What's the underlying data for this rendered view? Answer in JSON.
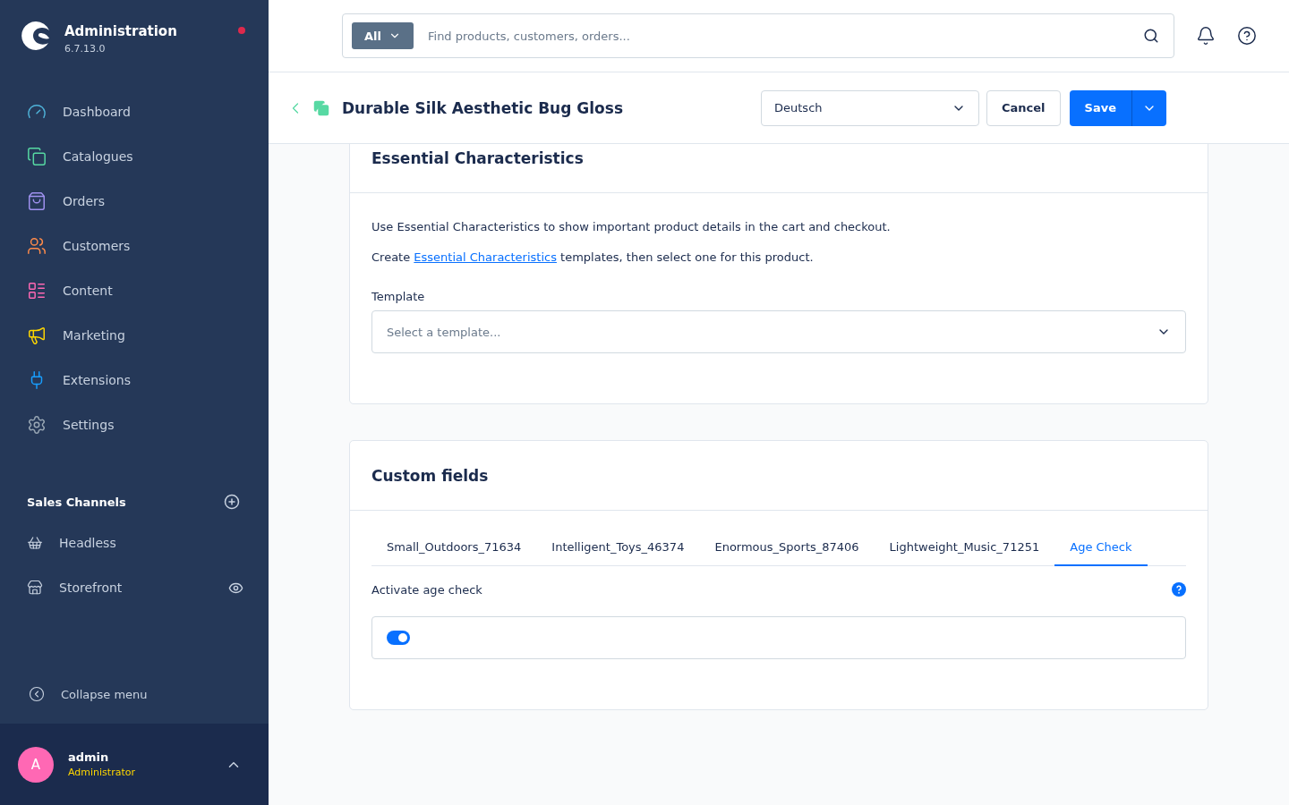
{
  "sidebar": {
    "brand": {
      "title": "Administration",
      "version": "6.7.13.0",
      "notification": true
    },
    "nav": [
      {
        "label": "Dashboard",
        "kind": "dashboard",
        "color": "#4fb3d9"
      },
      {
        "label": "Catalogues",
        "kind": "catalogues",
        "color": "#57d9a3"
      },
      {
        "label": "Orders",
        "kind": "orders",
        "color": "#a092f0"
      },
      {
        "label": "Customers",
        "kind": "customers",
        "color": "#ff8b4a"
      },
      {
        "label": "Content",
        "kind": "content",
        "color": "#ff68b4"
      },
      {
        "label": "Marketing",
        "kind": "marketing",
        "color": "#ffd700"
      },
      {
        "label": "Extensions",
        "kind": "extensions",
        "color": "#189eff"
      },
      {
        "label": "Settings",
        "kind": "settings",
        "color": "#9aa8b5"
      }
    ],
    "sales_channels": {
      "title": "Sales Channels",
      "items": [
        {
          "label": "Headless",
          "kind": "basket",
          "preview": false
        },
        {
          "label": "Storefront",
          "kind": "store",
          "preview": true
        }
      ]
    },
    "collapse": "Collapse menu",
    "user": {
      "initial": "A",
      "name": "admin",
      "role": "Administrator"
    }
  },
  "topbar": {
    "search": {
      "scope": "All",
      "placeholder": "Find products, customers, orders..."
    }
  },
  "header": {
    "title": "Durable Silk Aesthetic Bug Gloss",
    "language": "Deutsch",
    "buttons": {
      "cancel": "Cancel",
      "save": "Save"
    }
  },
  "essential": {
    "title": "Essential Characteristics",
    "intro": "Use Essential Characteristics to show important product details in the cart and checkout.",
    "before": "Create",
    "link": "Essential Characteristics",
    "after": "templates, then select one for this product.",
    "template_label": "Template",
    "template_placeholder": "Select a template..."
  },
  "custom_fields": {
    "title": "Custom fields",
    "tabs": [
      {
        "label": "Small_Outdoors_71634",
        "selected": false
      },
      {
        "label": "Intelligent_Toys_46374",
        "selected": false
      },
      {
        "label": "Enormous_Sports_87406",
        "selected": false
      },
      {
        "label": "Lightweight_Music_71251",
        "selected": false
      },
      {
        "label": "Age Check",
        "selected": true
      }
    ],
    "field_label": "Activate age check",
    "toggle_on": true
  }
}
